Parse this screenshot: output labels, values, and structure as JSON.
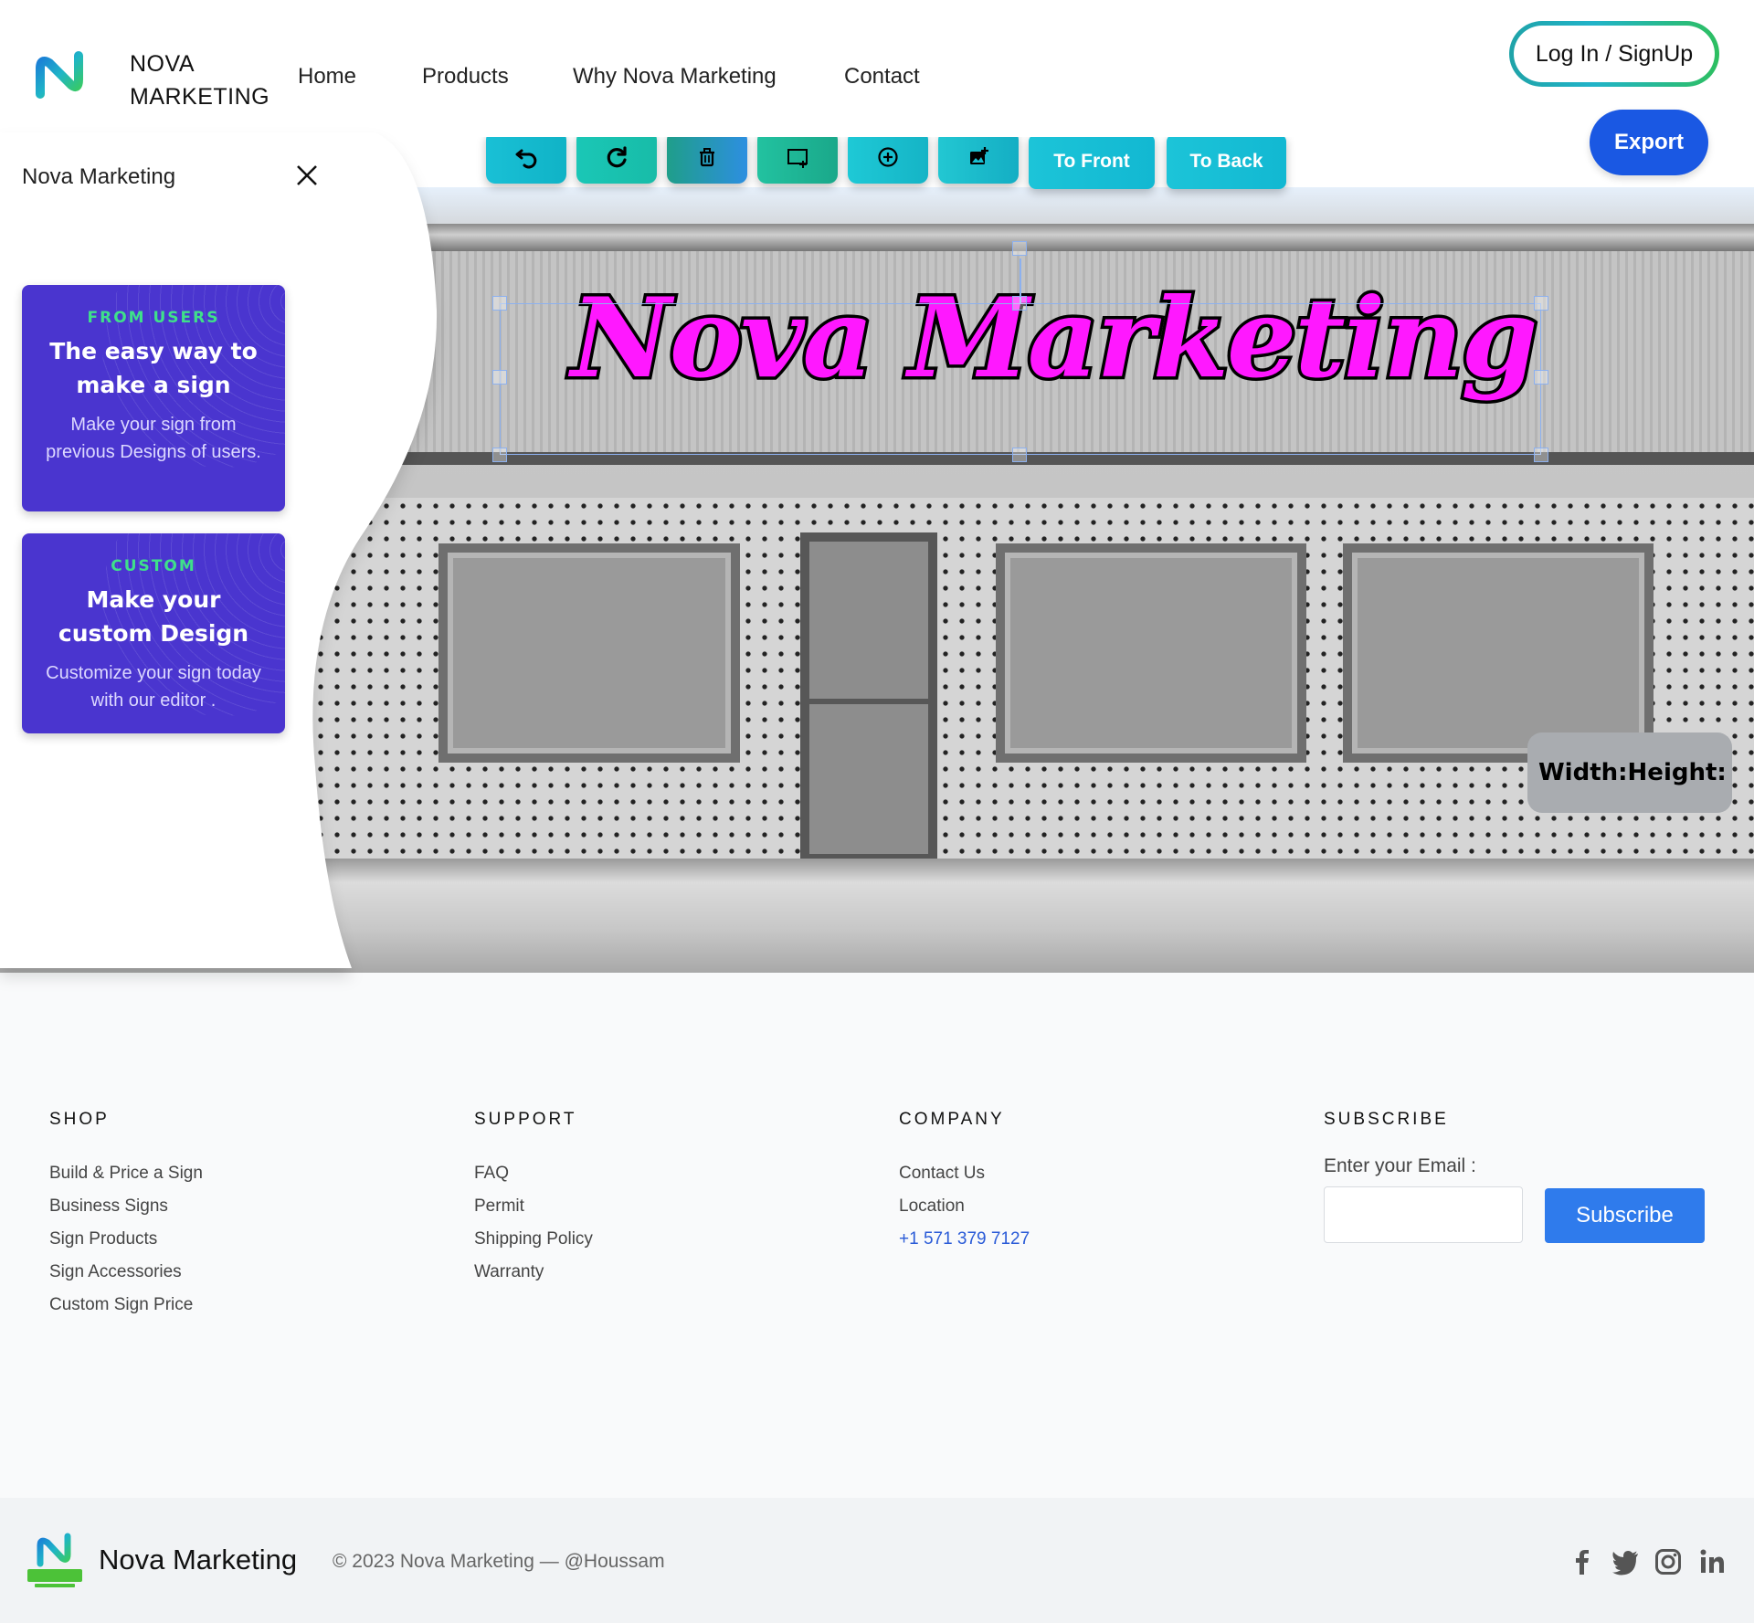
{
  "header": {
    "logo_line1": "NOVA",
    "logo_line2": "MARKETING",
    "nav": [
      "Home",
      "Products",
      "Why Nova Marketing",
      "Contact"
    ],
    "login_label": "Log In / SignUp",
    "export_label": "Export"
  },
  "toolbar": {
    "icons": [
      "undo-icon",
      "redo-icon",
      "trash-icon",
      "add-rectangle-icon",
      "add-circle-icon",
      "add-image-icon"
    ],
    "to_front_label": "To Front",
    "to_back_label": "To Back"
  },
  "canvas": {
    "sign_text": "Nova Marketing",
    "sign_fill_color": "#ff18ff",
    "sign_stroke_color": "#000000",
    "width_label": "Width:",
    "height_label": "Height:"
  },
  "panel": {
    "title": "Nova Marketing",
    "cards": [
      {
        "kicker": "FROM USERS",
        "headline_line1": "The easy way to",
        "headline_line2": "make a sign",
        "body": "Make your sign from previous Designs of users."
      },
      {
        "kicker": "CUSTOM",
        "headline_line1": "Make your",
        "headline_line2": "custom Design",
        "body": "Customize your sign today with our editor ."
      }
    ]
  },
  "footer": {
    "shop": {
      "title": "SHOP",
      "links": [
        "Build & Price a Sign",
        "Business Signs",
        "Sign Products",
        "Sign Accessories",
        "Custom Sign Price"
      ]
    },
    "support": {
      "title": "SUPPORT",
      "links": [
        "FAQ",
        "Permit",
        "Shipping Policy",
        "Warranty"
      ]
    },
    "company": {
      "title": "COMPANY",
      "links": [
        "Contact Us",
        "Location"
      ],
      "phone": "+1 571 379 7127"
    },
    "subscribe": {
      "title": "SUBSCRIBE",
      "email_label": "Enter your Email :",
      "email_value": "",
      "button_label": "Subscribe"
    }
  },
  "bottom_bar": {
    "brand": "Nova Marketing",
    "copyright": "© 2023 Nova Marketing — @Houssam",
    "social_icons": [
      "facebook-icon",
      "twitter-icon",
      "instagram-icon",
      "linkedin-icon"
    ]
  },
  "colors": {
    "accent_blue": "#1a58e3",
    "panel_card": "#4a35cf",
    "card_kicker": "#3fe08a",
    "toolbar_teal": "#1cc4d8",
    "subscribe_blue": "#2f7bec"
  }
}
